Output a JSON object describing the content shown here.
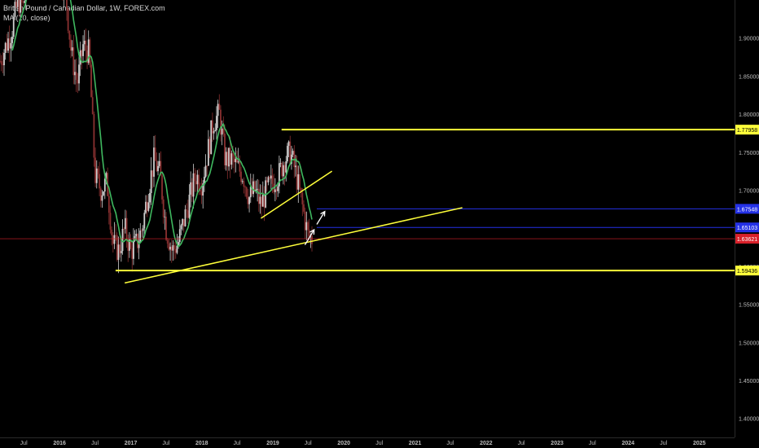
{
  "header": {
    "title": "British Pound / Canadian Dollar, 1W, FOREX.com",
    "indicator": "MA (10, close)"
  },
  "colors": {
    "background": "#000000",
    "up_candle": "#cfcfcf",
    "down_candle": "#8a3030",
    "ma_line": "#3fb85f",
    "trendline": "#ffff3a",
    "target_lines": "#2431e6",
    "current_price": "#d8202a",
    "axis_text": "#bdbdbd",
    "arrow": "#ffffff"
  },
  "chart_data": {
    "type": "candlestick",
    "title": "British Pound / Canadian Dollar, 1W, FOREX.com",
    "indicator": "MA (10, close)",
    "ylim": [
      1.375,
      1.95
    ],
    "y_ticks": [
      "1.90000",
      "1.85000",
      "1.80000",
      "1.75000",
      "1.70000",
      "1.65000",
      "1.60000",
      "1.55000",
      "1.50000",
      "1.45000",
      "1.40000"
    ],
    "x_ticks": [
      {
        "label": "Jul",
        "date": "2015-07-01"
      },
      {
        "label": "2016",
        "date": "2016-01-01"
      },
      {
        "label": "Jul",
        "date": "2016-07-01"
      },
      {
        "label": "2017",
        "date": "2017-01-01"
      },
      {
        "label": "Jul",
        "date": "2017-07-01"
      },
      {
        "label": "2018",
        "date": "2018-01-01"
      },
      {
        "label": "Jul",
        "date": "2018-07-01"
      },
      {
        "label": "2019",
        "date": "2019-01-01"
      },
      {
        "label": "Jul",
        "date": "2019-07-01"
      },
      {
        "label": "2020",
        "date": "2020-01-01"
      },
      {
        "label": "Jul",
        "date": "2020-07-01"
      },
      {
        "label": "2021",
        "date": "2021-01-01"
      },
      {
        "label": "Jul",
        "date": "2021-07-01"
      },
      {
        "label": "2022",
        "date": "2022-01-01"
      },
      {
        "label": "Jul",
        "date": "2022-07-01"
      },
      {
        "label": "2023",
        "date": "2023-01-01"
      },
      {
        "label": "Jul",
        "date": "2023-07-01"
      },
      {
        "label": "2024",
        "date": "2024-01-01"
      },
      {
        "label": "Jul",
        "date": "2024-07-01"
      },
      {
        "label": "2025",
        "date": "2025-01-01"
      }
    ],
    "x_domain": [
      "2015-03-01",
      "2025-07-01"
    ],
    "series_close": [
      [
        "2015-03-01",
        1.87
      ],
      [
        "2015-04-01",
        1.89
      ],
      [
        "2015-05-01",
        1.91
      ],
      [
        "2015-06-01",
        1.95
      ],
      [
        "2015-07-01",
        1.94
      ],
      [
        "2015-08-01",
        2.02
      ],
      [
        "2015-09-01",
        2.02
      ],
      [
        "2015-10-01",
        2.03
      ],
      [
        "2015-11-01",
        2.01
      ],
      [
        "2015-12-01",
        2.02
      ],
      [
        "2016-01-01",
        1.99
      ],
      [
        "2016-02-01",
        1.96
      ],
      [
        "2016-03-01",
        1.88
      ],
      [
        "2016-04-01",
        1.84
      ],
      [
        "2016-05-01",
        1.89
      ],
      [
        "2016-06-01",
        1.88
      ],
      [
        "2016-07-01",
        1.72
      ],
      [
        "2016-08-01",
        1.7
      ],
      [
        "2016-09-01",
        1.71
      ],
      [
        "2016-10-01",
        1.63
      ],
      [
        "2016-11-01",
        1.62
      ],
      [
        "2016-12-01",
        1.65
      ],
      [
        "2017-01-01",
        1.62
      ],
      [
        "2017-02-01",
        1.63
      ],
      [
        "2017-03-01",
        1.65
      ],
      [
        "2017-04-01",
        1.7
      ],
      [
        "2017-05-01",
        1.74
      ],
      [
        "2017-06-01",
        1.72
      ],
      [
        "2017-07-01",
        1.65
      ],
      [
        "2017-08-01",
        1.62
      ],
      [
        "2017-09-01",
        1.63
      ],
      [
        "2017-10-01",
        1.66
      ],
      [
        "2017-11-01",
        1.69
      ],
      [
        "2017-12-01",
        1.72
      ],
      [
        "2018-01-01",
        1.71
      ],
      [
        "2018-02-01",
        1.75
      ],
      [
        "2018-03-01",
        1.79
      ],
      [
        "2018-04-01",
        1.8
      ],
      [
        "2018-05-01",
        1.74
      ],
      [
        "2018-06-01",
        1.74
      ],
      [
        "2018-07-01",
        1.73
      ],
      [
        "2018-08-01",
        1.72
      ],
      [
        "2018-09-01",
        1.69
      ],
      [
        "2018-10-01",
        1.7
      ],
      [
        "2018-11-01",
        1.68
      ],
      [
        "2018-12-01",
        1.7
      ],
      [
        "2019-01-01",
        1.71
      ],
      [
        "2019-02-01",
        1.72
      ],
      [
        "2019-03-01",
        1.74
      ],
      [
        "2019-04-01",
        1.75
      ],
      [
        "2019-05-01",
        1.72
      ],
      [
        "2019-06-01",
        1.68
      ],
      [
        "2019-07-01",
        1.64
      ],
      [
        "2019-07-22",
        1.6362
      ]
    ],
    "ma_label": "MA (10, close)",
    "horizontal_levels": [
      {
        "price": 1.77958,
        "label": "1.77958",
        "color": "#ffff3a",
        "from": "2019-02-15"
      },
      {
        "price": 1.67548,
        "label": "1.67548",
        "color": "#2431e6",
        "from": "2019-08-15"
      },
      {
        "price": 1.65103,
        "label": "1.65103",
        "color": "#2431e6",
        "from": "2019-08-15"
      },
      {
        "price": 1.63621,
        "label": "1.63621",
        "color": "#d8202a",
        "from": "2015-03-01",
        "thin": true
      },
      {
        "price": 1.59436,
        "label": "1.59436",
        "color": "#ffff3a",
        "from": "2016-10-15"
      }
    ],
    "trendlines": [
      {
        "from": [
          "2016-12-01",
          1.578
        ],
        "to": [
          "2021-09-01",
          1.677
        ],
        "color": "#ffff3a"
      },
      {
        "from": [
          "2018-11-01",
          1.663
        ],
        "to": [
          "2019-11-01",
          1.725
        ],
        "color": "#ffff3a"
      }
    ],
    "arrows": [
      {
        "from": [
          "2019-06-15",
          1.628
        ],
        "to": [
          "2019-08-01",
          1.648
        ]
      },
      {
        "from": [
          "2019-08-15",
          1.655
        ],
        "to": [
          "2019-09-25",
          1.672
        ]
      }
    ],
    "grid": false
  }
}
